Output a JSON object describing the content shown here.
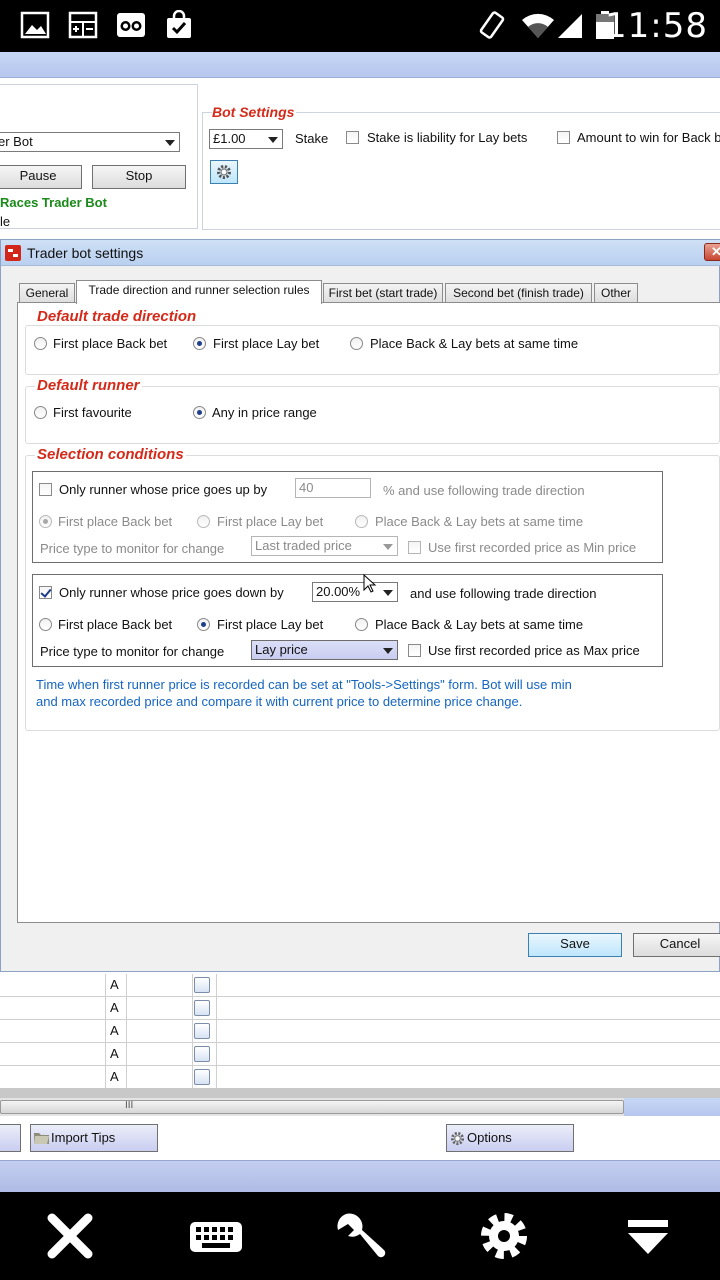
{
  "statusbar": {
    "time": "11:58"
  },
  "bot_panel": {
    "bot_select": "er Bot",
    "pause_label": "Pause",
    "stop_label": "Stop",
    "bot_name": "Races Trader Bot",
    "bot_sub": "le"
  },
  "bot_settings": {
    "title": "Bot Settings",
    "stake_value": "£1.00",
    "stake_label": "Stake",
    "liability_label": "Stake is liability for Lay bets",
    "amount_label": "Amount to win for Back b"
  },
  "dialog": {
    "title": "Trader bot settings",
    "tabs": [
      "General",
      "Trade direction and runner selection rules",
      "First bet (start trade)",
      "Second bet (finish trade)",
      "Other"
    ],
    "default_trade_direction": {
      "title": "Default trade direction",
      "options": [
        "First place Back bet",
        "First place Lay bet",
        "Place Back & Lay bets at same time"
      ]
    },
    "default_runner": {
      "title": "Default runner",
      "options": [
        "First favourite",
        "Any in price range"
      ]
    },
    "selection_conditions": {
      "title": "Selection conditions",
      "up": {
        "label": "Only runner whose price goes up by",
        "value": "40",
        "suffix": "% and use following trade direction",
        "options": [
          "First place Back bet",
          "First place Lay bet",
          "Place Back & Lay bets at same time"
        ],
        "price_type_label": "Price type to monitor for change",
        "price_type_value": "Last traded price",
        "first_recorded_label": "Use first recorded price as Min price"
      },
      "down": {
        "label": "Only runner whose price goes down by",
        "value": "20.00%",
        "suffix": "and use following trade direction",
        "options": [
          "First place Back bet",
          "First place Lay bet",
          "Place Back & Lay bets at same time"
        ],
        "price_type_label": "Price type to monitor for change",
        "price_type_value": "Lay price",
        "first_recorded_label": "Use first recorded price as Max price"
      },
      "info_line1": "Time when first runner price is recorded can be set at \"Tools->Settings\" form. Bot will use min",
      "info_line2": "and max recorded price and compare it with current price to determine price change."
    },
    "save_label": "Save",
    "cancel_label": "Cancel"
  },
  "grid": {
    "rows": [
      "A",
      "A",
      "A",
      "A",
      "A"
    ]
  },
  "scroll_marker": "III",
  "bottom": {
    "import_tips_label": "Import Tips",
    "options_label": "Options"
  },
  "colors": {
    "header_red": "#d42a1a",
    "info_blue": "#1565c0",
    "bot_name_green": "#1a8a1a"
  }
}
